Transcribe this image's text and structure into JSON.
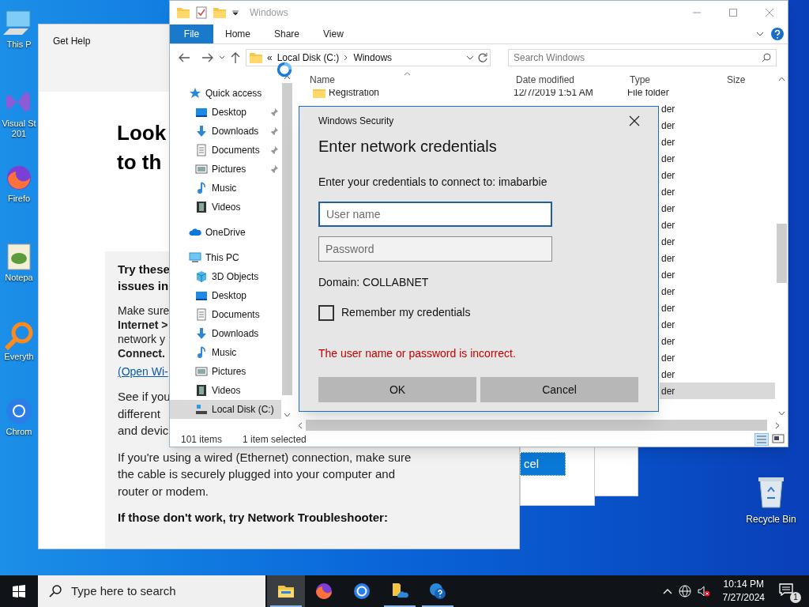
{
  "desktop_icons": [
    {
      "kind": "pc",
      "lines": [
        "This P"
      ]
    },
    {
      "kind": "vs",
      "lines": [
        "Visual St",
        "201"
      ]
    },
    {
      "kind": "firefox",
      "lines": [
        "Firefo"
      ]
    },
    {
      "kind": "notepad",
      "lines": [
        "Notepa"
      ]
    },
    {
      "kind": "search",
      "lines": [
        "Everyth"
      ]
    },
    {
      "kind": "chrome",
      "lines": [
        "Chrom"
      ]
    }
  ],
  "recycle_bin": {
    "label": "Recycle Bin"
  },
  "get_help": {
    "title": "Get Help",
    "heading": "Look\nto th",
    "paragraphs": [
      {
        "kind": "heading",
        "text": "Try these\nissues in"
      },
      {
        "kind": "list",
        "text": "Make sure\n**Internet >**\nnetwork y\n**Connect.**"
      },
      {
        "kind": "link",
        "text": "(Open Wi-"
      },
      {
        "kind": "text",
        "text": "See if you\ndifferent\nand devic"
      },
      {
        "kind": "text",
        "text": "If you're using a wired (Ethernet) connection, make sure the cable is securely plugged into your computer and router or modem."
      },
      {
        "kind": "heading",
        "text": "If those don't work, try Network Troubleshooter:"
      }
    ]
  },
  "background_dialog": {
    "button": "cel"
  },
  "explorer": {
    "title": "Windows",
    "ribbon_tabs": [
      {
        "label": "File",
        "selected": true
      },
      {
        "label": "Home",
        "selected": false
      },
      {
        "label": "Share",
        "selected": false
      },
      {
        "label": "View",
        "selected": false
      }
    ],
    "address": {
      "overflow": "«",
      "segments": [
        "Local Disk (C:)",
        "Windows"
      ]
    },
    "search": {
      "placeholder": "Search Windows"
    },
    "nav": [
      {
        "label": "Quick access",
        "kind": "star",
        "children": [
          {
            "label": "Desktop",
            "kind": "desktop",
            "pinned": true,
            "selected": false
          },
          {
            "label": "Downloads",
            "kind": "downloads",
            "pinned": true,
            "selected": false
          },
          {
            "label": "Documents",
            "kind": "documents",
            "pinned": true,
            "selected": false
          },
          {
            "label": "Pictures",
            "kind": "pictures",
            "pinned": true,
            "selected": false
          },
          {
            "label": "Music",
            "kind": "music",
            "pinned": false,
            "selected": false
          },
          {
            "label": "Videos",
            "kind": "videos",
            "pinned": false,
            "selected": false
          }
        ]
      },
      {
        "label": "OneDrive",
        "kind": "cloud"
      },
      {
        "label": "This PC",
        "kind": "pc",
        "children": [
          {
            "label": "3D Objects",
            "kind": "cube",
            "pinned": false,
            "selected": false
          },
          {
            "label": "Desktop",
            "kind": "desktop",
            "pinned": false,
            "selected": false
          },
          {
            "label": "Documents",
            "kind": "documents",
            "pinned": false,
            "selected": false
          },
          {
            "label": "Downloads",
            "kind": "downloads",
            "pinned": false,
            "selected": false
          },
          {
            "label": "Music",
            "kind": "music",
            "pinned": false,
            "selected": false
          },
          {
            "label": "Pictures",
            "kind": "pictures",
            "pinned": false,
            "selected": false
          },
          {
            "label": "Videos",
            "kind": "videos",
            "pinned": false,
            "selected": false
          },
          {
            "label": "Local Disk (C:)",
            "kind": "disk",
            "pinned": false,
            "selected": true
          }
        ]
      }
    ],
    "columns": [
      "Name",
      "Date modified",
      "Type",
      "Size"
    ],
    "rows": [
      {
        "name": "Registration",
        "date": "12/7/2019 1:51 AM",
        "type": "File folder",
        "selected": false
      },
      {
        "type": "der",
        "selected": false
      },
      {
        "type": "der",
        "selected": false
      },
      {
        "type": "der",
        "selected": false
      },
      {
        "type": "der",
        "selected": false
      },
      {
        "type": "der",
        "selected": false
      },
      {
        "type": "der",
        "selected": false
      },
      {
        "type": "der",
        "selected": false
      },
      {
        "type": "der",
        "selected": false
      },
      {
        "type": "der",
        "selected": false
      },
      {
        "type": "der",
        "selected": false
      },
      {
        "type": "der",
        "selected": false
      },
      {
        "type": "der",
        "selected": false
      },
      {
        "type": "der",
        "selected": false
      },
      {
        "type": "der",
        "selected": false
      },
      {
        "type": "der",
        "selected": false
      },
      {
        "type": "der",
        "selected": false
      },
      {
        "type": "der",
        "selected": false
      },
      {
        "type": "der",
        "selected": true
      }
    ],
    "status": [
      "101 items",
      "1 item selected"
    ]
  },
  "dialog": {
    "caption": "Windows Security",
    "heading": "Enter network credentials",
    "prompt": "Enter your credentials to connect to: imabarbie",
    "fields": [
      {
        "placeholder": "User name",
        "focused": true
      },
      {
        "placeholder": "Password",
        "focused": false
      }
    ],
    "domain": "Domain: COLLABNET",
    "remember": {
      "label": "Remember my credentials",
      "checked": false
    },
    "error": "The user name or password is incorrect.",
    "buttons": [
      "OK",
      "Cancel"
    ]
  },
  "taskbar": {
    "search": {
      "placeholder": "Type here to search"
    },
    "apps": [
      {
        "kind": "explorer",
        "active": true,
        "running": true
      },
      {
        "kind": "firefox",
        "active": false,
        "running": false
      },
      {
        "kind": "chrome",
        "active": false,
        "running": false
      },
      {
        "kind": "folder-cloud",
        "active": false,
        "running": true
      },
      {
        "kind": "help",
        "active": false,
        "running": true
      }
    ],
    "time": "10:14 PM",
    "date": "7/27/2024",
    "notifications": "1"
  }
}
